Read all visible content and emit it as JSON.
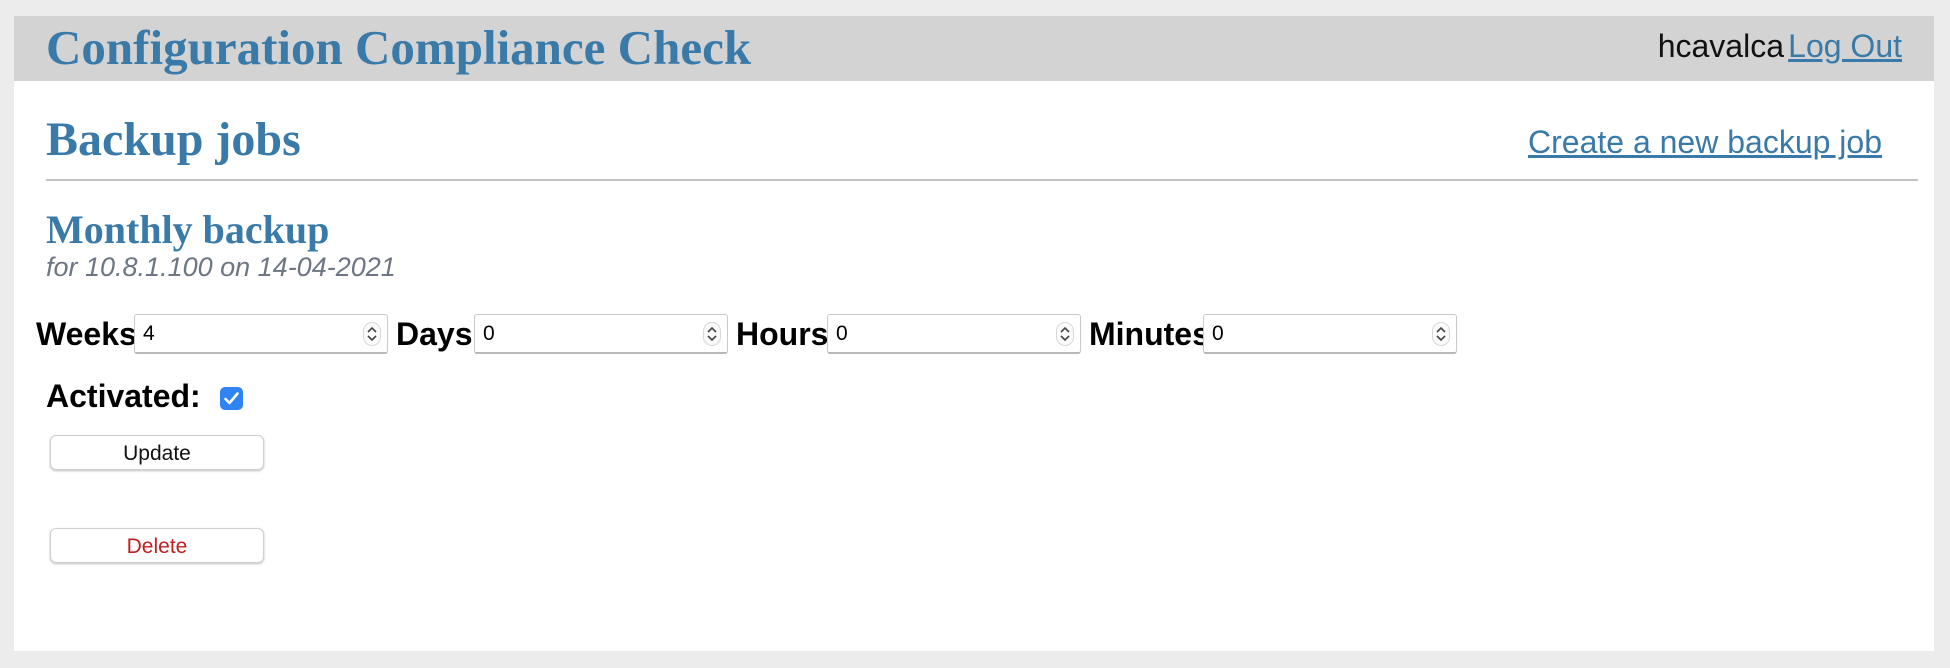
{
  "header": {
    "app_title": "Configuration Compliance Check",
    "username": "hcavalca",
    "logout_label": "Log Out"
  },
  "page": {
    "title": "Backup jobs",
    "create_link_label": "Create a new backup job"
  },
  "job": {
    "title": "Monthly backup",
    "subtitle": "for 10.8.1.100 on 14-04-2021",
    "fields": {
      "weeks": {
        "label": "Weeks:",
        "value": "4"
      },
      "days": {
        "label": "Days:",
        "value": "0"
      },
      "hours": {
        "label": "Hours:",
        "value": "0"
      },
      "minutes": {
        "label": "Minutes:",
        "value": "0"
      }
    },
    "activated": {
      "label": "Activated:",
      "checked": true
    },
    "update_label": "Update",
    "delete_label": "Delete"
  },
  "colors": {
    "accent": "#3a7aa8",
    "header_bg": "#d3d3d3",
    "checkbox": "#2f83f2",
    "delete_text": "#c11f1f",
    "subtitle": "#6d7682"
  }
}
